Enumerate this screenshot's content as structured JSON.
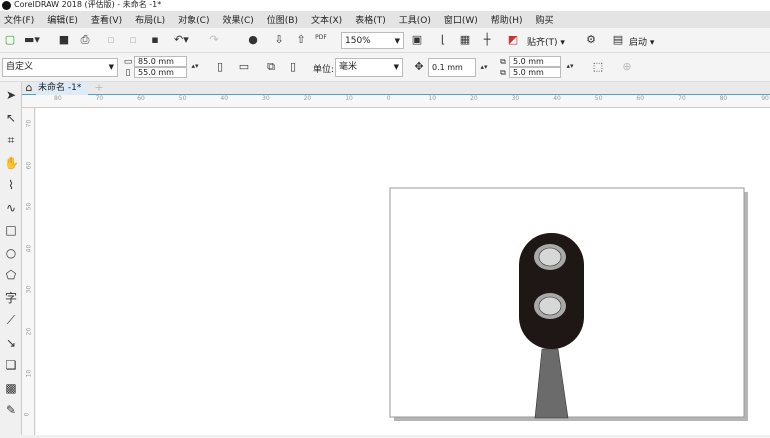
{
  "title": "CorelDRAW 2018 (评估版) - 未命名 -1*",
  "menu": [
    "文件(F)",
    "编辑(E)",
    "查看(V)",
    "布局(L)",
    "对象(C)",
    "效果(C)",
    "位图(B)",
    "文本(X)",
    "表格(T)",
    "工具(O)",
    "窗口(W)",
    "帮助(H)",
    "购买"
  ],
  "toolbar": {
    "zoom": "150%",
    "snap": "贴齐(T)",
    "launch": "启动"
  },
  "property_bar": {
    "page_preset": "自定义",
    "width": "85.0 mm",
    "height": "55.0 mm",
    "units_label": "单位:",
    "units": "毫米",
    "nudge": "0.1 mm",
    "dup_x": "5.0 mm",
    "dup_y": "5.0 mm"
  },
  "doc_tab": "未命名 -1*",
  "ruler_h": [
    "80",
    "70",
    "60",
    "50",
    "40",
    "30",
    "20",
    "10",
    "0",
    "10",
    "20",
    "30",
    "40",
    "50",
    "60",
    "70",
    "80",
    "90"
  ],
  "ruler_v": [
    "70",
    "60",
    "50",
    "40",
    "30",
    "20",
    "10",
    "0"
  ],
  "tools": [
    "pick-tool",
    "freehand-pick-tool",
    "crop-tool",
    "pan-tool",
    "freehand-tool",
    "artistic-media-tool",
    "rectangle-tool",
    "ellipse-tool",
    "polygon-tool",
    "text-tool",
    "parallel-dimension-tool",
    "connector-tool",
    "drop-shadow-tool",
    "transparency-tool",
    "color-eyedropper-tool"
  ],
  "colors": {
    "signal_head": "#1e1715",
    "lamp": "#d6d8d8",
    "lamp_ring": "#a9a9a9",
    "pole": "#6b6b6b",
    "ruler_accent": "#4aa3df"
  }
}
